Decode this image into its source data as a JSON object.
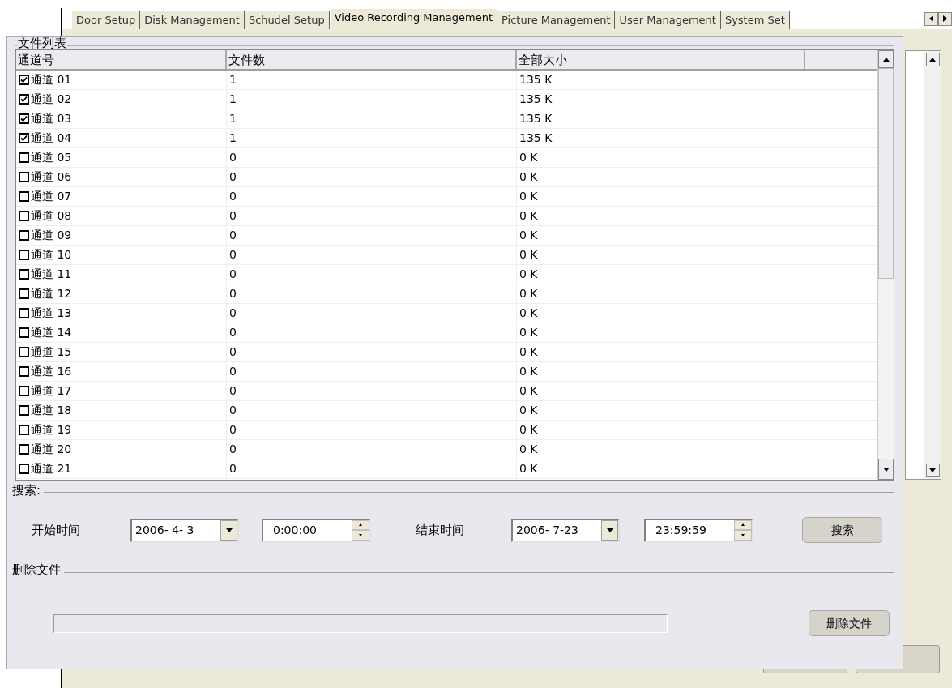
{
  "tabs": [
    {
      "label": "Door Setup",
      "selected": false
    },
    {
      "label": "Disk Management",
      "selected": false
    },
    {
      "label": "Schudel Setup",
      "selected": false
    },
    {
      "label": "Video Recording Management",
      "selected": true
    },
    {
      "label": "Picture Management",
      "selected": false
    },
    {
      "label": "User Management",
      "selected": false
    },
    {
      "label": "System Set",
      "selected": false
    }
  ],
  "file_list": {
    "title": "文件列表",
    "columns": [
      "通道号",
      "文件数",
      "全部大小"
    ],
    "rows": [
      {
        "channel": "通道 01",
        "files": "1",
        "size": "135 K",
        "checked": true
      },
      {
        "channel": "通道 02",
        "files": "1",
        "size": "135 K",
        "checked": true
      },
      {
        "channel": "通道 03",
        "files": "1",
        "size": "135 K",
        "checked": true
      },
      {
        "channel": "通道 04",
        "files": "1",
        "size": "135 K",
        "checked": true
      },
      {
        "channel": "通道 05",
        "files": "0",
        "size": "0 K",
        "checked": false
      },
      {
        "channel": "通道 06",
        "files": "0",
        "size": "0 K",
        "checked": false
      },
      {
        "channel": "通道 07",
        "files": "0",
        "size": "0 K",
        "checked": false
      },
      {
        "channel": "通道 08",
        "files": "0",
        "size": "0 K",
        "checked": false
      },
      {
        "channel": "通道 09",
        "files": "0",
        "size": "0 K",
        "checked": false
      },
      {
        "channel": "通道 10",
        "files": "0",
        "size": "0 K",
        "checked": false
      },
      {
        "channel": "通道 11",
        "files": "0",
        "size": "0 K",
        "checked": false
      },
      {
        "channel": "通道 12",
        "files": "0",
        "size": "0 K",
        "checked": false
      },
      {
        "channel": "通道 13",
        "files": "0",
        "size": "0 K",
        "checked": false
      },
      {
        "channel": "通道 14",
        "files": "0",
        "size": "0 K",
        "checked": false
      },
      {
        "channel": "通道 15",
        "files": "0",
        "size": "0 K",
        "checked": false
      },
      {
        "channel": "通道 16",
        "files": "0",
        "size": "0 K",
        "checked": false
      },
      {
        "channel": "通道 17",
        "files": "0",
        "size": "0 K",
        "checked": false
      },
      {
        "channel": "通道 18",
        "files": "0",
        "size": "0 K",
        "checked": false
      },
      {
        "channel": "通道 19",
        "files": "0",
        "size": "0 K",
        "checked": false
      },
      {
        "channel": "通道 20",
        "files": "0",
        "size": "0 K",
        "checked": false
      },
      {
        "channel": "通道 21",
        "files": "0",
        "size": "0 K",
        "checked": false
      }
    ]
  },
  "search": {
    "title": "搜索:",
    "start_label": "开始时间",
    "start_date": "2006- 4- 3",
    "start_time": "0:00:00",
    "end_label": "结束时间",
    "end_date": "2006- 7-23",
    "end_time": "23:59:59",
    "button": "搜索"
  },
  "delete": {
    "title": "删除文件",
    "button": "删除文件"
  }
}
